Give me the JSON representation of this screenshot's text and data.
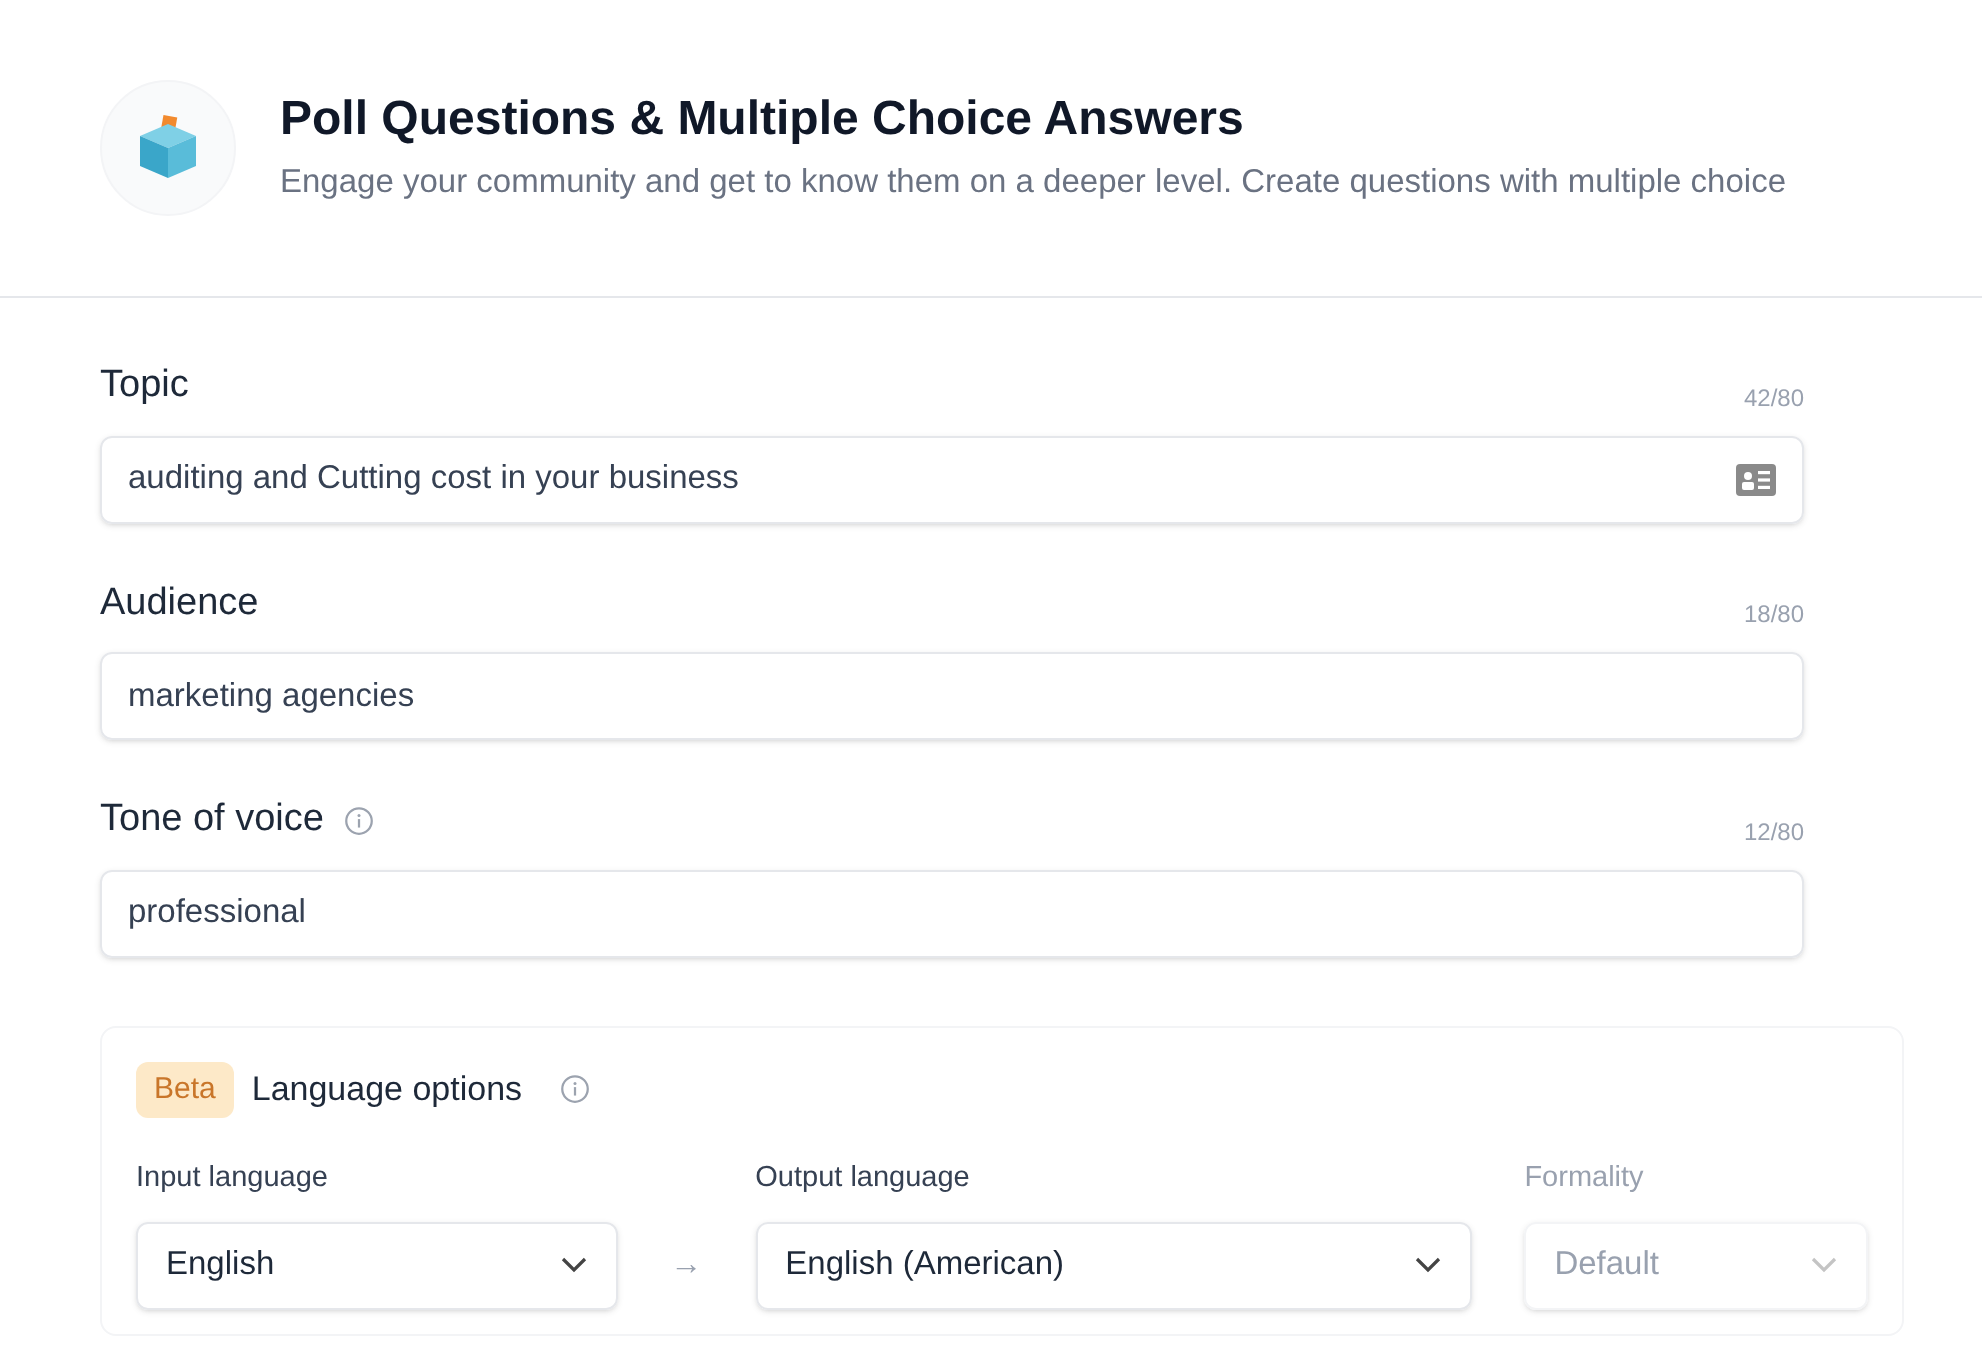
{
  "header": {
    "title": "Poll Questions & Multiple Choice Answers",
    "subtitle": "Engage your community and get to know them on a deeper level. Create questions with multiple choice"
  },
  "fields": [
    {
      "label": "Topic",
      "counter": "42/80",
      "value": "auditing and Cutting cost in your business",
      "info": false,
      "trailing_icon": true
    },
    {
      "label": "Audience",
      "counter": "18/80",
      "value": "marketing agencies",
      "info": false,
      "trailing_icon": false
    },
    {
      "label": "Tone of voice",
      "counter": "12/80",
      "value": "professional",
      "info": true,
      "trailing_icon": false
    }
  ],
  "language_options": {
    "badge": "Beta",
    "title": "Language options",
    "arrow": "→",
    "selects": [
      {
        "label": "Input language",
        "value": "English",
        "disabled": false
      },
      {
        "label": "Output language",
        "value": "English (American)",
        "disabled": false
      },
      {
        "label": "Formality",
        "value": "Default",
        "disabled": true
      }
    ]
  }
}
